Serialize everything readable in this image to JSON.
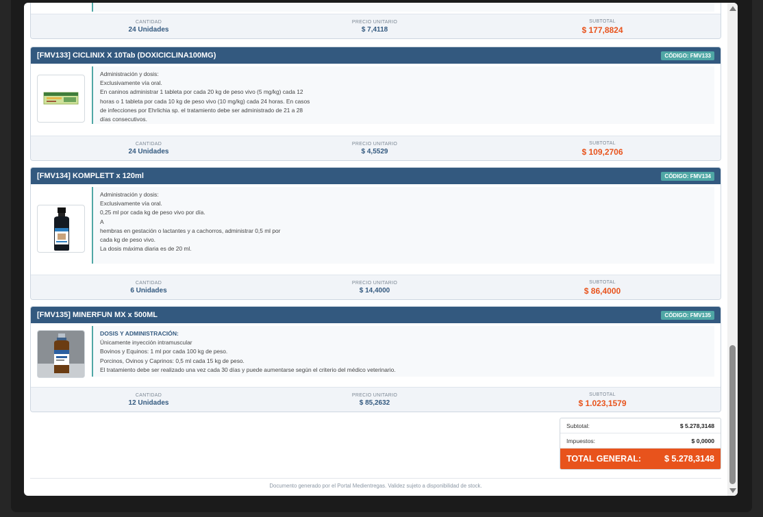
{
  "items": [
    {
      "footer": {
        "qty_label": "CANTIDAD",
        "qty": "24 Unidades",
        "price_label": "PRECIO UNITARIO",
        "price": "$ 7,4118",
        "sub_label": "SUBTOTAL",
        "subtotal": "$ 177,8824"
      }
    },
    {
      "title": "[FMV133] CICLINIX X 10Tab (DOXICICLINA100MG)",
      "code": "CÓDIGO: FMV133",
      "desc": [
        "Administración y dosis:",
        "Exclusivamente vía oral.",
        "En caninos administrar 1 tableta por cada 20 kg de peso vivo (5 mg/kg) cada 12",
        "horas o 1 tableta por cada 10 kg de peso vivo (10 mg/kg) cada 24 horas. En casos",
        "de infecciones por Ehrlichia sp. el tratamiento debe ser administrado de 21 a 28",
        "días consecutivos."
      ],
      "footer": {
        "qty_label": "CANTIDAD",
        "qty": "24 Unidades",
        "price_label": "PRECIO UNITARIO",
        "price": "$ 4,5529",
        "sub_label": "SUBTOTAL",
        "subtotal": "$ 109,2706"
      }
    },
    {
      "title": "[FMV134] KOMPLETT x 120ml",
      "code": "CÓDIGO: FMV134",
      "desc": [
        "Administración y dosis:",
        "Exclusivamente vía oral.",
        "0,25 ml por cada kg de peso vivo por día.",
        "A",
        "hembras en gestación o lactantes y a cachorros, administrar 0,5 ml por",
        "cada kg de peso vivo.",
        "La dosis máxima diaria es de 20 ml."
      ],
      "footer": {
        "qty_label": "CANTIDAD",
        "qty": "6 Unidades",
        "price_label": "PRECIO UNITARIO",
        "price": "$ 14,4000",
        "sub_label": "SUBTOTAL",
        "subtotal": "$ 86,4000"
      }
    },
    {
      "title": "[FMV135] MINERFUN MX x 500ML",
      "code": "CÓDIGO: FMV135",
      "desc_heading": "DOSIS Y ADMINISTRACIÓN:",
      "desc": [
        "Únicamente inyección intramuscular",
        "Bovinos y Equinos: 1 ml por cada 100 kg de peso.",
        "Porcinos, Ovinos y Caprinos: 0,5 ml cada 15 kg de peso.",
        "El tratamiento debe ser realizado una vez cada 30 días y puede aumentarse según el criterio del médico veterinario."
      ],
      "footer": {
        "qty_label": "CANTIDAD",
        "qty": "12 Unidades",
        "price_label": "PRECIO UNITARIO",
        "price": "$ 85,2632",
        "sub_label": "SUBTOTAL",
        "subtotal": "$ 1.023,1579"
      }
    }
  ],
  "totals": {
    "subtotal_label": "Subtotal:",
    "subtotal": "$ 5.278,3148",
    "tax_label": "Impuestos:",
    "tax": "$ 0,0000",
    "grand_label": "TOTAL GENERAL:",
    "grand": "$ 5.278,3148"
  },
  "footer_note": "Documento generado por el Portal Medientregas. Validez sujeto a disponibilidad de stock.",
  "colors": {
    "header": "#33597f",
    "accent": "#4fa7a5",
    "subtotal": "#e8531c"
  }
}
